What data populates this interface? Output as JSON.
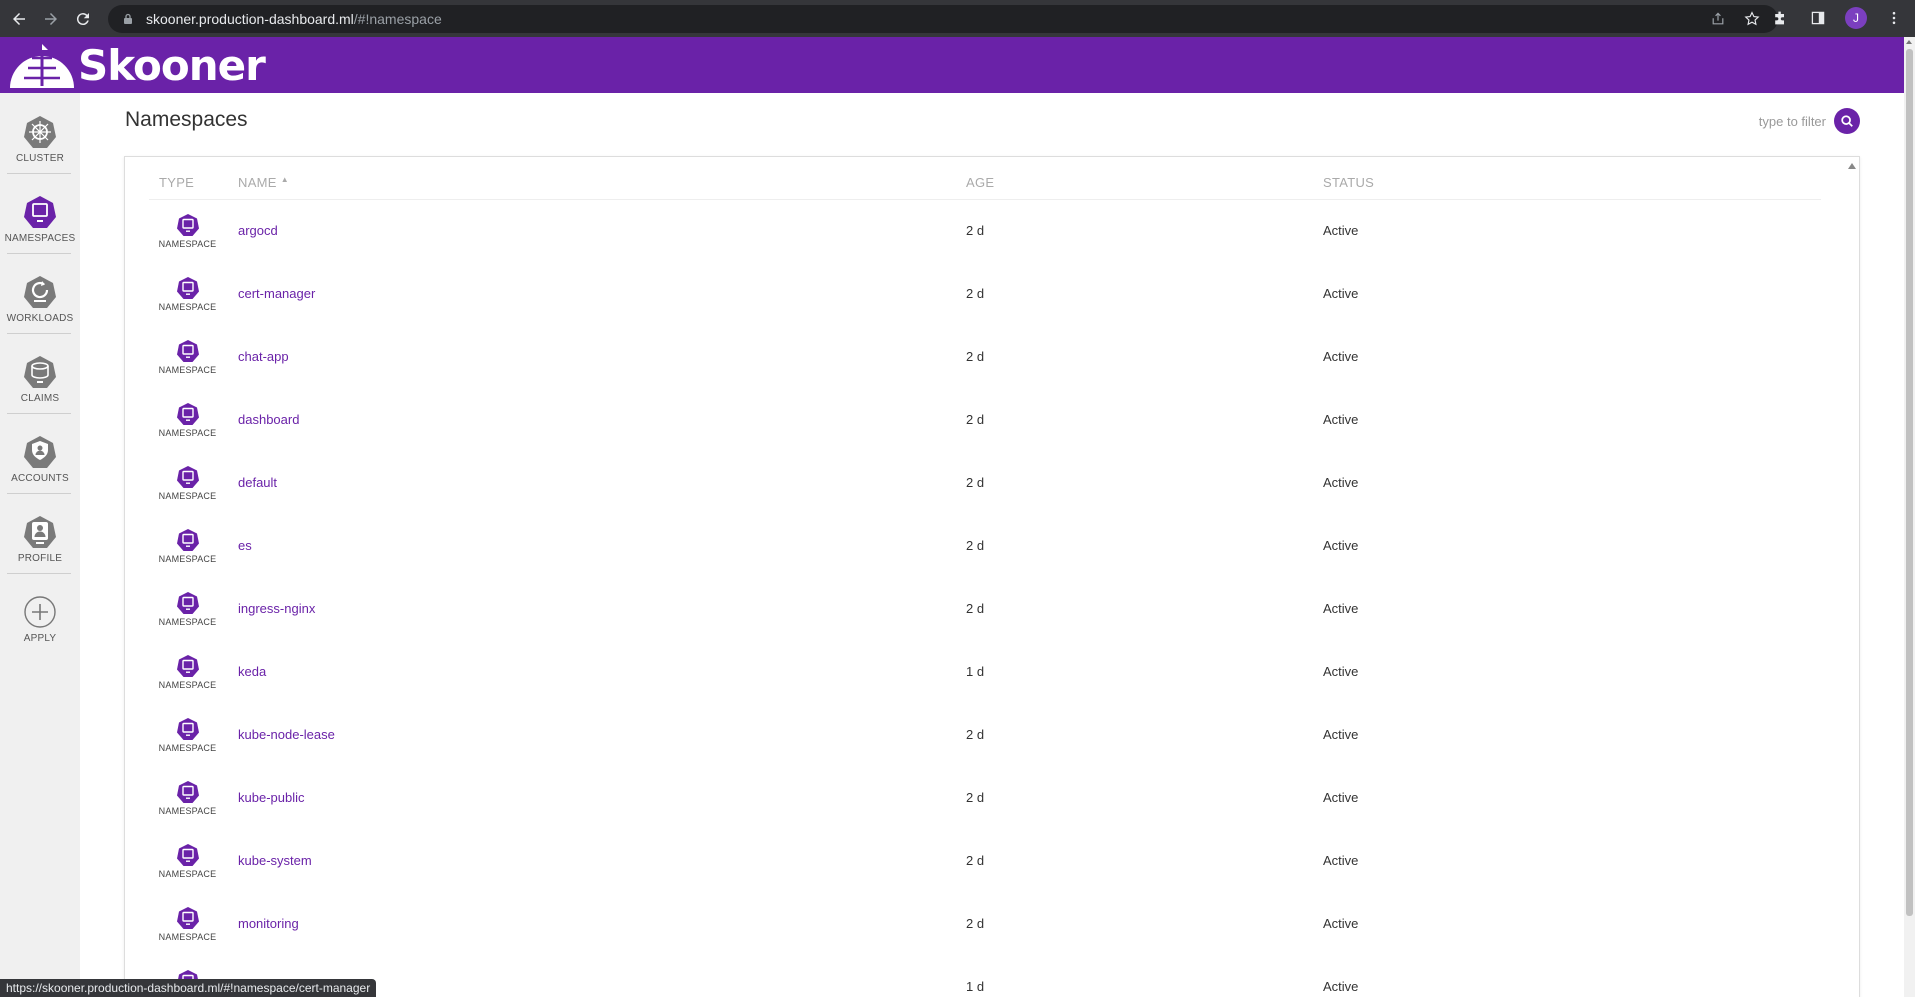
{
  "browser": {
    "url_host": "skooner.production-dashboard.ml",
    "url_rest": "/#!namespace",
    "avatar_letter": "J",
    "status_url": "https://skooner.production-dashboard.ml/#!namespace/cert-manager"
  },
  "app": {
    "brand": "Skooner",
    "brand_color": "#6a22a8"
  },
  "sidebar": {
    "items": [
      {
        "label": "CLUSTER",
        "icon": "cluster-icon"
      },
      {
        "label": "NAMESPACES",
        "icon": "namespace-icon",
        "active": true
      },
      {
        "label": "WORKLOADS",
        "icon": "workloads-icon"
      },
      {
        "label": "CLAIMS",
        "icon": "claims-icon"
      },
      {
        "label": "ACCOUNTS",
        "icon": "accounts-icon"
      },
      {
        "label": "PROFILE",
        "icon": "profile-icon"
      },
      {
        "label": "APPLY",
        "icon": "apply-plus-icon"
      }
    ]
  },
  "page": {
    "title": "Namespaces",
    "filter_placeholder": "type to filter"
  },
  "table": {
    "headers": {
      "type": "TYPE",
      "name": "NAME",
      "age": "AGE",
      "status": "STATUS"
    },
    "rows": [
      {
        "type": "NAMESPACE",
        "name": "argocd",
        "age": "2 d",
        "status": "Active"
      },
      {
        "type": "NAMESPACE",
        "name": "cert-manager",
        "age": "2 d",
        "status": "Active"
      },
      {
        "type": "NAMESPACE",
        "name": "chat-app",
        "age": "2 d",
        "status": "Active"
      },
      {
        "type": "NAMESPACE",
        "name": "dashboard",
        "age": "2 d",
        "status": "Active"
      },
      {
        "type": "NAMESPACE",
        "name": "default",
        "age": "2 d",
        "status": "Active"
      },
      {
        "type": "NAMESPACE",
        "name": "es",
        "age": "2 d",
        "status": "Active"
      },
      {
        "type": "NAMESPACE",
        "name": "ingress-nginx",
        "age": "2 d",
        "status": "Active"
      },
      {
        "type": "NAMESPACE",
        "name": "keda",
        "age": "1 d",
        "status": "Active"
      },
      {
        "type": "NAMESPACE",
        "name": "kube-node-lease",
        "age": "2 d",
        "status": "Active"
      },
      {
        "type": "NAMESPACE",
        "name": "kube-public",
        "age": "2 d",
        "status": "Active"
      },
      {
        "type": "NAMESPACE",
        "name": "kube-system",
        "age": "2 d",
        "status": "Active"
      },
      {
        "type": "NAMESPACE",
        "name": "monitoring",
        "age": "2 d",
        "status": "Active"
      },
      {
        "type": "NAMESPACE",
        "name": "",
        "age": "1 d",
        "status": "Active"
      }
    ]
  }
}
